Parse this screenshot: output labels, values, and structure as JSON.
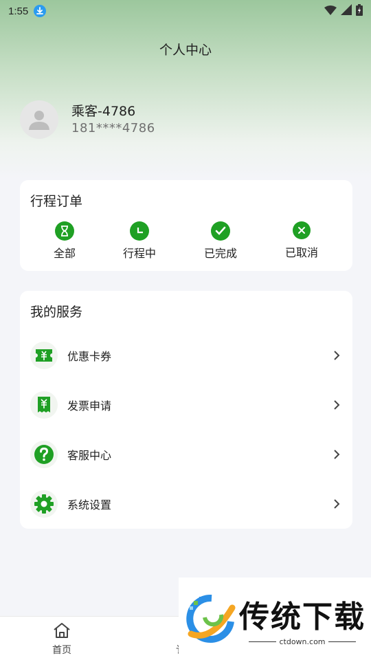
{
  "status_bar": {
    "time": "1:55"
  },
  "header": {
    "title": "个人中心"
  },
  "user": {
    "name": "乘客-4786",
    "phone": "181****4786"
  },
  "orders": {
    "title": "行程订单",
    "items": [
      {
        "label": "全部",
        "icon": "hourglass-icon"
      },
      {
        "label": "行程中",
        "icon": "clock-icon"
      },
      {
        "label": "已完成",
        "icon": "check-icon"
      },
      {
        "label": "已取消",
        "icon": "cancel-icon"
      }
    ]
  },
  "services": {
    "title": "我的服务",
    "items": [
      {
        "label": "优惠卡券",
        "icon": "coupon-icon"
      },
      {
        "label": "发票申请",
        "icon": "invoice-icon"
      },
      {
        "label": "客服中心",
        "icon": "help-icon"
      },
      {
        "label": "系统设置",
        "icon": "settings-icon"
      }
    ]
  },
  "bottom_nav": {
    "home_label": "首页",
    "partial_label": "讠"
  },
  "watermark": {
    "title": "传统下载",
    "url": "ctdown.com"
  },
  "colors": {
    "accent": "#1fa024",
    "background": "#f4f5f9"
  }
}
